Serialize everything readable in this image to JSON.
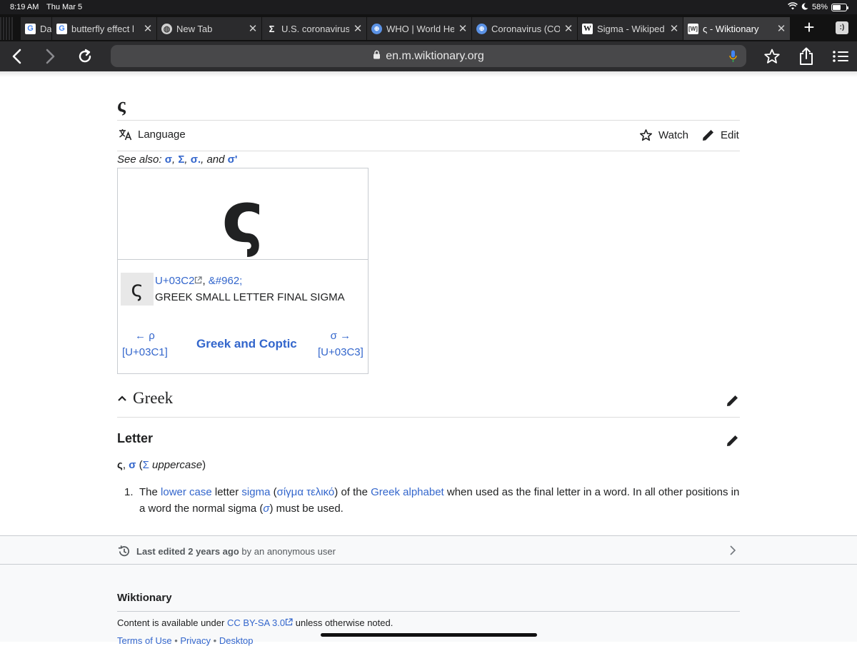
{
  "status": {
    "time": "8:19 AM",
    "date": "Thu Mar 5",
    "battery": "58%"
  },
  "tabs": [
    {
      "title": "Da",
      "icon": "google-icon"
    },
    {
      "title": "butterfly effect l",
      "icon": "google-icon"
    },
    {
      "title": "New Tab",
      "icon": "globe-icon"
    },
    {
      "title": "U.S. coronavirus",
      "icon": "sigma-icon"
    },
    {
      "title": "WHO | World He",
      "icon": "who-icon"
    },
    {
      "title": "Coronavirus (CO",
      "icon": "who-icon"
    },
    {
      "title": "Sigma - Wikiped",
      "icon": "wikipedia-icon"
    },
    {
      "title": "ς - Wiktionary",
      "icon": "wiktionary-icon"
    }
  ],
  "toolbar": {
    "url": "en.m.wiktionary.org"
  },
  "page": {
    "title": "ς",
    "actions": {
      "language": "Language",
      "watch": "Watch",
      "edit": "Edit"
    },
    "see_also": {
      "prefix": "See also:",
      "links": [
        "σ",
        "Σ",
        "σ.",
        "σ'"
      ],
      "and": "and"
    },
    "charbox": {
      "glyph": "ς",
      "codepoint": "U+03C2",
      "entity": "&#962;",
      "name": "GREEK SMALL LETTER FINAL SIGMA",
      "prev_char": "← ρ",
      "prev_code": "[U+03C1]",
      "block": "Greek and Coptic",
      "next_char": "σ →",
      "next_code": "[U+03C3]"
    },
    "section": "Greek",
    "subsection": "Letter",
    "headword": {
      "word": "ς",
      "alt": "σ",
      "upper": "Σ",
      "upper_label": "uppercase"
    },
    "definition": {
      "num": "1.",
      "t1": "The ",
      "l1": "lower case",
      "t2": " letter ",
      "l2": "sigma",
      "t3": " (",
      "l3": "σίγμα τελικό",
      "t4": ") of the ",
      "l4": "Greek alphabet",
      "t5": " when used as the final letter in a word. In all other positions in a word the normal sigma (",
      "l5": "σ",
      "t6": ") must be used."
    },
    "last_edited": {
      "bold": "Last edited 2 years ago",
      "rest": "by an anonymous user"
    },
    "footer": {
      "site": "Wiktionary",
      "lic_prefix": "Content is available under",
      "lic_link": "CC BY-SA 3.0",
      "lic_suffix": "unless otherwise noted.",
      "links": [
        "Terms of Use",
        "Privacy",
        "Desktop"
      ]
    }
  }
}
